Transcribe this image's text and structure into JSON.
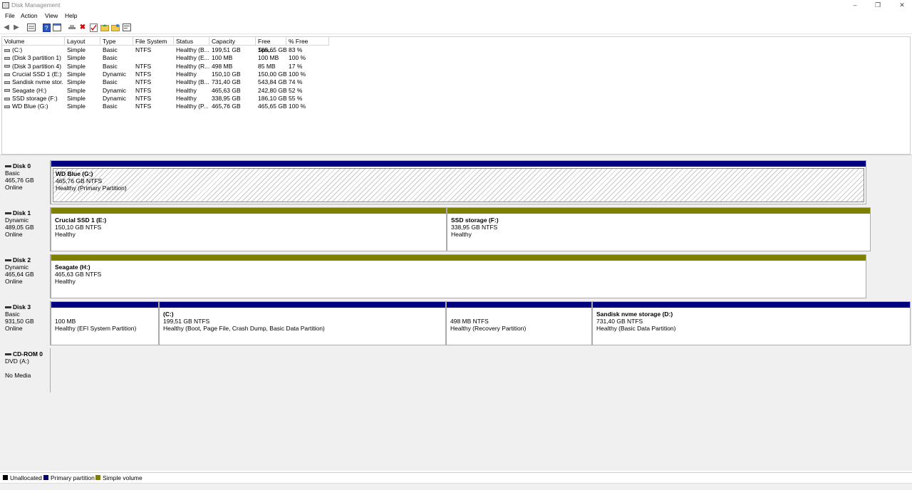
{
  "window": {
    "title": "Disk Management",
    "minimize": "–",
    "restore": "❐",
    "close": "✕"
  },
  "menu": [
    "File",
    "Action",
    "View",
    "Help"
  ],
  "toolbar_icons": [
    "back-icon",
    "forward-icon",
    "properties-view-icon",
    "help-icon",
    "console-view-icon",
    "connect-icon",
    "delete-icon",
    "check-icon",
    "up-folder-icon",
    "folder-open-icon",
    "settings-icon"
  ],
  "columns": [
    "Volume",
    "Layout",
    "Type",
    "File System",
    "Status",
    "Capacity",
    "Free Spa...",
    "% Free"
  ],
  "volumes": [
    {
      "volume": "(C:)",
      "layout": "Simple",
      "type": "Basic",
      "fs": "NTFS",
      "status": "Healthy (B...",
      "capacity": "199,51 GB",
      "free": "165,65 GB",
      "pct": "83 %"
    },
    {
      "volume": "(Disk 3 partition 1)",
      "layout": "Simple",
      "type": "Basic",
      "fs": "",
      "status": "Healthy (E...",
      "capacity": "100 MB",
      "free": "100 MB",
      "pct": "100 %"
    },
    {
      "volume": "(Disk 3 partition 4)",
      "layout": "Simple",
      "type": "Basic",
      "fs": "NTFS",
      "status": "Healthy (R...",
      "capacity": "498 MB",
      "free": "85 MB",
      "pct": "17 %"
    },
    {
      "volume": "Crucial SSD 1 (E:)",
      "layout": "Simple",
      "type": "Dynamic",
      "fs": "NTFS",
      "status": "Healthy",
      "capacity": "150,10 GB",
      "free": "150,00 GB",
      "pct": "100 %"
    },
    {
      "volume": "Sandisk nvme stor...",
      "layout": "Simple",
      "type": "Basic",
      "fs": "NTFS",
      "status": "Healthy (B...",
      "capacity": "731,40 GB",
      "free": "543,84 GB",
      "pct": "74 %"
    },
    {
      "volume": "Seagate (H:)",
      "layout": "Simple",
      "type": "Dynamic",
      "fs": "NTFS",
      "status": "Healthy",
      "capacity": "465,63 GB",
      "free": "242,80 GB",
      "pct": "52 %"
    },
    {
      "volume": "SSD storage (F:)",
      "layout": "Simple",
      "type": "Dynamic",
      "fs": "NTFS",
      "status": "Healthy",
      "capacity": "338,95 GB",
      "free": "186,10 GB",
      "pct": "55 %"
    },
    {
      "volume": "WD Blue (G:)",
      "layout": "Simple",
      "type": "Basic",
      "fs": "NTFS",
      "status": "Healthy (P...",
      "capacity": "465,76 GB",
      "free": "465,65 GB",
      "pct": "100 %"
    }
  ],
  "disks": [
    {
      "name": "Disk 0",
      "type": "Basic",
      "size": "465,76 GB",
      "state": "Online",
      "partitions": [
        {
          "name": "WD Blue  (G:)",
          "size": "465,76 GB NTFS",
          "status": "Healthy (Primary Partition)",
          "kind": "primary",
          "selected": true
        }
      ]
    },
    {
      "name": "Disk 1",
      "type": "Dynamic",
      "size": "489,05 GB",
      "state": "Online",
      "partitions": [
        {
          "name": "Crucial SSD 1  (E:)",
          "size": "150,10 GB NTFS",
          "status": "Healthy",
          "kind": "simple"
        },
        {
          "name": "SSD storage  (F:)",
          "size": "338,95 GB NTFS",
          "status": "Healthy",
          "kind": "simple"
        }
      ]
    },
    {
      "name": "Disk 2",
      "type": "Dynamic",
      "size": "465,64 GB",
      "state": "Online",
      "partitions": [
        {
          "name": "Seagate  (H:)",
          "size": "465,63 GB NTFS",
          "status": "Healthy",
          "kind": "simple"
        }
      ]
    },
    {
      "name": "Disk 3",
      "type": "Basic",
      "size": "931,50 GB",
      "state": "Online",
      "partitions": [
        {
          "name": "",
          "size": "100 MB",
          "status": "Healthy (EFI System Partition)",
          "kind": "primary"
        },
        {
          "name": "(C:)",
          "size": "199,51 GB NTFS",
          "status": "Healthy (Boot, Page File, Crash Dump, Basic Data Partition)",
          "kind": "primary"
        },
        {
          "name": "",
          "size": "498 MB NTFS",
          "status": "Healthy (Recovery Partition)",
          "kind": "primary"
        },
        {
          "name": "Sandisk nvme storage  (D:)",
          "size": "731,40 GB NTFS",
          "status": "Healthy (Basic Data Partition)",
          "kind": "primary"
        }
      ]
    }
  ],
  "cdrom": {
    "name": "CD-ROM 0",
    "type": "DVD (A:)",
    "state": "No Media"
  },
  "legend": [
    {
      "label": "Unallocated",
      "color": "#000000"
    },
    {
      "label": "Primary partition",
      "color": "#000080"
    },
    {
      "label": "Simple volume",
      "color": "#808000"
    }
  ]
}
